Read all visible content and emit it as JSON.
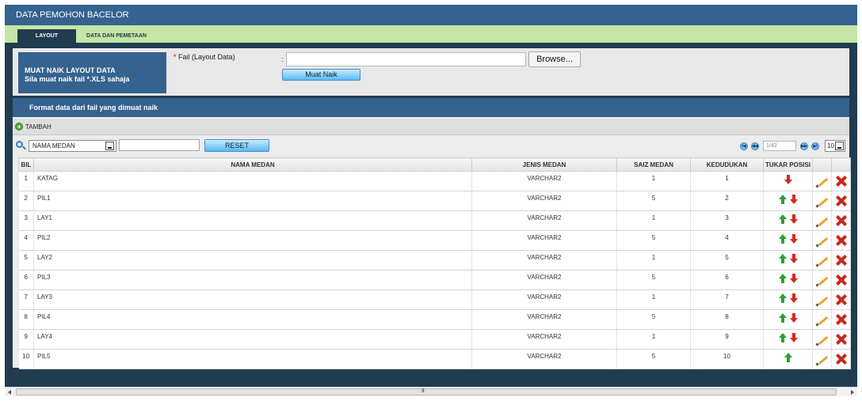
{
  "header": {
    "title": "DATA PEMOHON BACELOR"
  },
  "tabs": [
    {
      "label": "LAYOUT",
      "active": true
    },
    {
      "label": "DATA DAN PEMETAAN",
      "active": false
    }
  ],
  "upload": {
    "panel_title": "MUAT NAIK LAYOUT DATA",
    "panel_subtitle": "Sila muat naik fail *.XLS sahaja",
    "required_mark": "*",
    "field_label": "Fail (Layout Data)",
    "colon": ":",
    "file_value": "",
    "browse_label": "Browse...",
    "submit_label": "Muat Naik"
  },
  "format_bar": {
    "title": "Format data dari fail yang dimuat naik"
  },
  "toolbar": {
    "add_label": "TAMBAH"
  },
  "search": {
    "field_selected": "NAMA MEDAN",
    "query": "",
    "reset_label": "RESET"
  },
  "pager": {
    "first": "I◀",
    "prev": "◀◀",
    "page_value": "1/42",
    "next": "▶▶",
    "last": "▶I",
    "per_page": "10"
  },
  "table": {
    "columns": [
      "BIL",
      "NAMA MEDAN",
      "JENIS MEDAN",
      "SAIZ MEDAN",
      "KEDUDUKAN",
      "TUKAR POSISI",
      "",
      ""
    ],
    "rows": [
      {
        "bil": "1",
        "nama": "KATAG",
        "jenis": "VARCHAR2",
        "saiz": "1",
        "kedudukan": "1",
        "up": false,
        "down": true
      },
      {
        "bil": "2",
        "nama": "PIL1",
        "jenis": "VARCHAR2",
        "saiz": "5",
        "kedudukan": "2",
        "up": true,
        "down": true
      },
      {
        "bil": "3",
        "nama": "LAY1",
        "jenis": "VARCHAR2",
        "saiz": "1",
        "kedudukan": "3",
        "up": true,
        "down": true
      },
      {
        "bil": "4",
        "nama": "PIL2",
        "jenis": "VARCHAR2",
        "saiz": "5",
        "kedudukan": "4",
        "up": true,
        "down": true
      },
      {
        "bil": "5",
        "nama": "LAY2",
        "jenis": "VARCHAR2",
        "saiz": "1",
        "kedudukan": "5",
        "up": true,
        "down": true
      },
      {
        "bil": "6",
        "nama": "PIL3",
        "jenis": "VARCHAR2",
        "saiz": "5",
        "kedudukan": "6",
        "up": true,
        "down": true
      },
      {
        "bil": "7",
        "nama": "LAY3",
        "jenis": "VARCHAR2",
        "saiz": "1",
        "kedudukan": "7",
        "up": true,
        "down": true
      },
      {
        "bil": "8",
        "nama": "PIL4",
        "jenis": "VARCHAR2",
        "saiz": "5",
        "kedudukan": "8",
        "up": true,
        "down": true
      },
      {
        "bil": "9",
        "nama": "LAY4",
        "jenis": "VARCHAR2",
        "saiz": "1",
        "kedudukan": "9",
        "up": true,
        "down": true
      },
      {
        "bil": "10",
        "nama": "PIL5",
        "jenis": "VARCHAR2",
        "saiz": "5",
        "kedudukan": "10",
        "up": true,
        "down": false
      }
    ]
  },
  "scrollbar": {
    "grip": "III"
  },
  "colors": {
    "header_blue": "#35628f",
    "tab_green": "#c5e6a6",
    "frame_dark": "#203c4f",
    "up_arrow": "#2e9e3a",
    "down_arrow": "#d42a1e",
    "delete_red": "#c8281c"
  },
  "icons": {
    "add": "add-circle-icon",
    "search": "search-icon",
    "move_up": "arrow-up-icon",
    "move_down": "arrow-down-icon",
    "edit": "pencil-icon",
    "delete": "delete-x-icon"
  }
}
